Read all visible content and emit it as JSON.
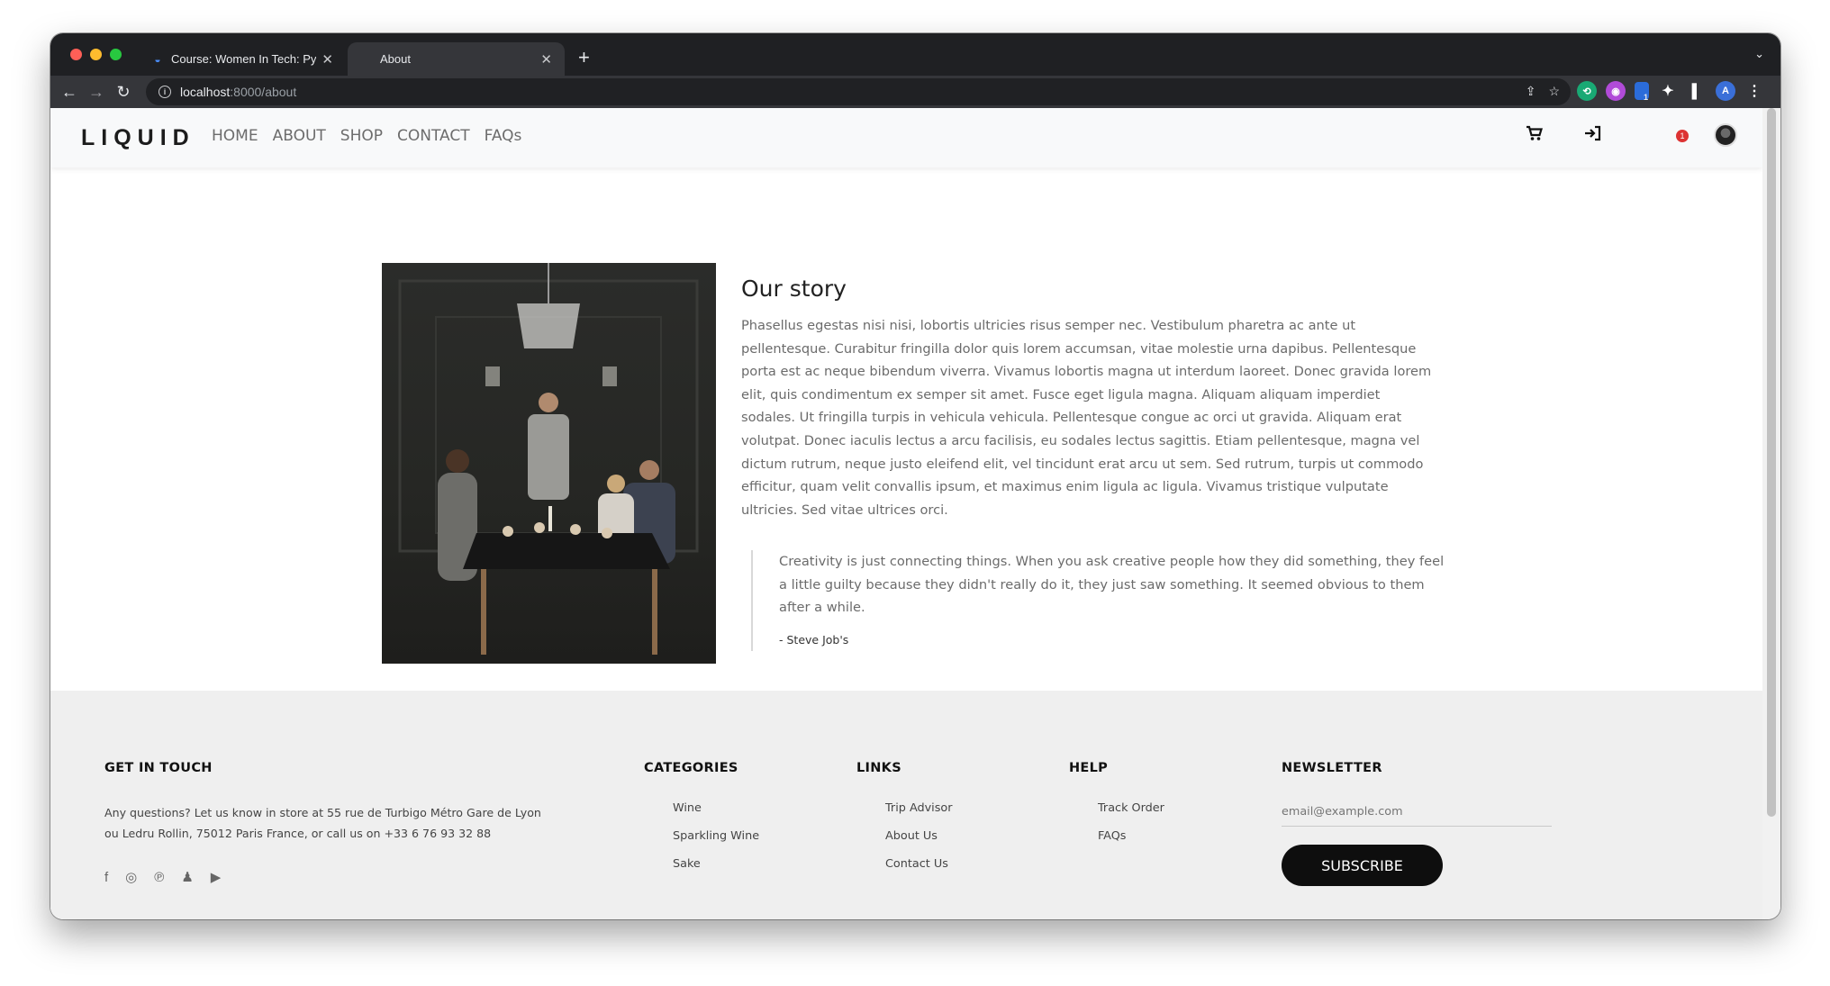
{
  "browser": {
    "tabs": [
      {
        "title": "Course: Women In Tech: Pytho",
        "active": false
      },
      {
        "title": "About",
        "active": true
      }
    ],
    "url_host": "localhost",
    "url_path": ":8000/about",
    "extension_badge": "1"
  },
  "nav": {
    "logo": "LIQUID",
    "links": [
      "HOME",
      "ABOUT",
      "SHOP",
      "CONTACT",
      "FAQs"
    ],
    "notification_count": "1"
  },
  "story": {
    "heading": "Our story",
    "body": "Phasellus egestas nisi nisi, lobortis ultricies risus semper nec. Vestibulum pharetra ac ante ut pellentesque. Curabitur fringilla dolor quis lorem accumsan, vitae molestie urna dapibus. Pellentesque porta est ac neque bibendum viverra. Vivamus lobortis magna ut interdum laoreet. Donec gravida lorem elit, quis condimentum ex semper sit amet. Fusce eget ligula magna. Aliquam aliquam imperdiet sodales. Ut fringilla turpis in vehicula vehicula. Pellentesque congue ac orci ut gravida. Aliquam erat volutpat. Donec iaculis lectus a arcu facilisis, eu sodales lectus sagittis. Etiam pellentesque, magna vel dictum rutrum, neque justo eleifend elit, vel tincidunt erat arcu ut sem. Sed rutrum, turpis ut commodo efficitur, quam velit convallis ipsum, et maximus enim ligula ac ligula. Vivamus tristique vulputate ultricies. Sed vitae ultrices orci.",
    "quote": "Creativity is just connecting things. When you ask creative people how they did something, they feel a little guilty because they didn't really do it, they just saw something. It seemed obvious to them after a while.",
    "quote_author": "- Steve Job's"
  },
  "footer": {
    "get_in_touch": {
      "heading": "GET IN TOUCH",
      "text": "Any questions? Let us know in store at 55 rue de Turbigo Métro Gare de Lyon ou Ledru Rollin, 75012 Paris France, or call us on +33 6 76 93 32 88"
    },
    "categories": {
      "heading": "CATEGORIES",
      "items": [
        "Wine",
        "Sparkling Wine",
        "Sake"
      ]
    },
    "links": {
      "heading": "LINKS",
      "items": [
        "Trip Advisor",
        "About Us",
        "Contact Us"
      ]
    },
    "help": {
      "heading": "HELP",
      "items": [
        "Track Order",
        "FAQs"
      ]
    },
    "newsletter": {
      "heading": "NEWSLETTER",
      "placeholder": "email@example.com",
      "button": "SUBSCRIBE"
    },
    "socials": [
      "facebook-icon",
      "instagram-icon",
      "pinterest-icon",
      "snapchat-icon",
      "youtube-icon"
    ]
  }
}
